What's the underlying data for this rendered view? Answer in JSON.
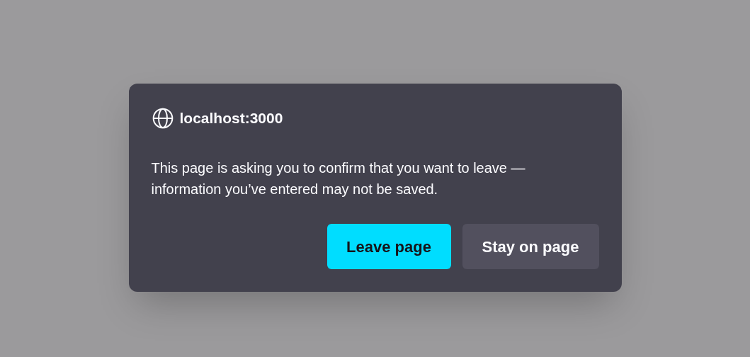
{
  "dialog": {
    "title": "localhost:3000",
    "message": "This page is asking you to confirm that you want to leave — information you’ve entered may not be saved.",
    "buttons": [
      {
        "label": "Leave page",
        "kind": "primary"
      },
      {
        "label": "Stay on page",
        "kind": "secondary"
      }
    ]
  }
}
